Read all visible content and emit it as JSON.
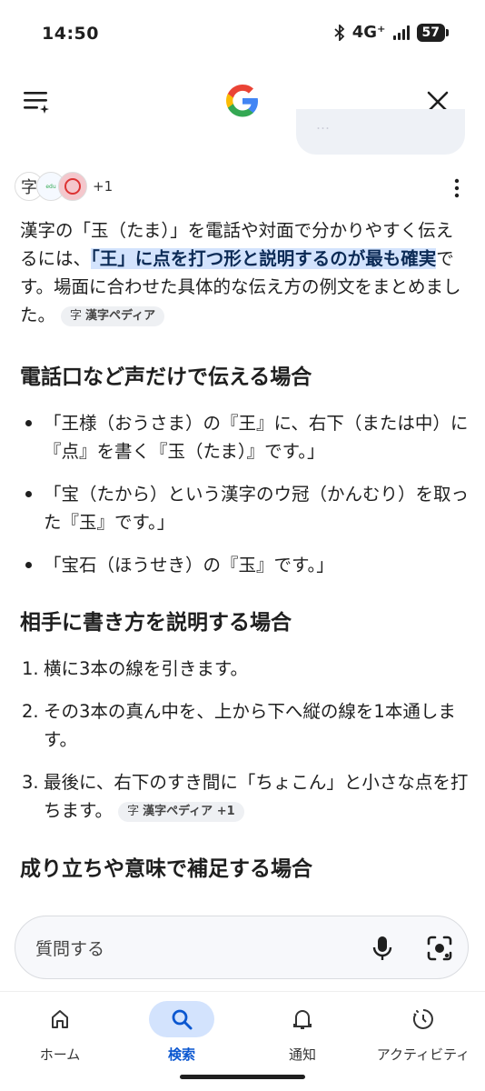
{
  "status": {
    "time": "14:50",
    "network": "4G⁺",
    "battery": "57"
  },
  "previous_message": "…",
  "sources": {
    "kanji_badge": "字",
    "edu_badge": "edu",
    "more": "+1"
  },
  "answer": {
    "intro_plain_1": "漢字の「玉（たま）」を電話や対面で分かりやすく伝えるには、",
    "intro_highlight": "「王」に点を打つ形と説明するのが最も確実",
    "intro_plain_2": "です。場面に合わせた具体的な伝え方の例文をまとめました。",
    "chip_1": {
      "icon": "字",
      "label": "漢字ペディア"
    },
    "section_voice": {
      "heading": "電話口など声だけで伝える場合",
      "items": [
        "「王様（おうさま）の『王』に、右下（または中）に『点』を書く『玉（たま）』です。」",
        "「宝（たから）という漢字のウ冠（かんむり）を取った『玉』です。」",
        "「宝石（ほうせき）の『玉』です。」"
      ]
    },
    "section_write": {
      "heading": "相手に書き方を説明する場合",
      "items": [
        {
          "num": "1.",
          "text": "横に3本の線を引きます。"
        },
        {
          "num": "2.",
          "text": "その3本の真ん中を、上から下へ縦の線を1本通します。"
        },
        {
          "num": "3.",
          "text": "最後に、右下のすき間に「ちょこん」と小さな点を打ちます。"
        }
      ],
      "chip": {
        "icon": "字",
        "label": "漢字ペディア +1"
      }
    },
    "section_origin": {
      "heading": "成り立ちや意味で補足する場合"
    }
  },
  "ask": {
    "placeholder": "質問する"
  },
  "nav": [
    {
      "label": "ホーム",
      "icon": "home-icon"
    },
    {
      "label": "検索",
      "icon": "search-icon",
      "active": true
    },
    {
      "label": "通知",
      "icon": "bell-icon"
    },
    {
      "label": "アクティビティ",
      "icon": "activity-icon"
    }
  ],
  "colors": {
    "accent": "#0b57d0",
    "highlight": "#d3e3fd"
  }
}
